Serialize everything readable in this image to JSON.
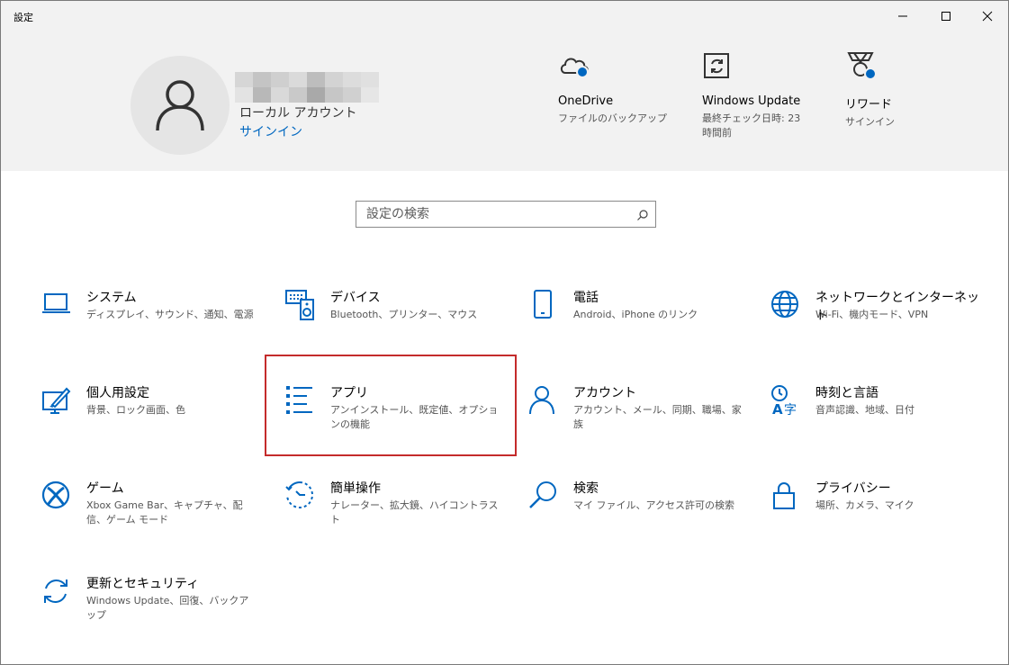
{
  "window": {
    "title": "設定"
  },
  "header": {
    "account_type": "ローカル アカウント",
    "signin_label": "サインイン",
    "quick_links": [
      {
        "title": "OneDrive",
        "sub": "ファイルのバックアップ",
        "icon": "onedrive-icon"
      },
      {
        "title": "Windows Update",
        "sub": "最終チェック日時: 23 時間前",
        "icon": "windows-update-icon"
      },
      {
        "title": "リワード",
        "sub": "サインイン",
        "icon": "rewards-icon"
      }
    ]
  },
  "search": {
    "placeholder": "設定の検索"
  },
  "categories": [
    {
      "title": "システム",
      "sub": "ディスプレイ、サウンド、通知、電源",
      "icon": "laptop-icon"
    },
    {
      "title": "デバイス",
      "sub": "Bluetooth、プリンター、マウス",
      "icon": "keyboard-speaker-icon"
    },
    {
      "title": "電話",
      "sub": "Android、iPhone のリンク",
      "icon": "phone-icon"
    },
    {
      "title": "ネットワークとインターネット",
      "sub": "Wi-Fi、機内モード、VPN",
      "icon": "globe-icon"
    },
    {
      "title": "個人用設定",
      "sub": "背景、ロック画面、色",
      "icon": "personalization-icon"
    },
    {
      "title": "アプリ",
      "sub": "アンインストール、既定値、オプションの機能",
      "icon": "apps-list-icon"
    },
    {
      "title": "アカウント",
      "sub": "アカウント、メール、同期、職場、家族",
      "icon": "person-icon"
    },
    {
      "title": "時刻と言語",
      "sub": "音声認識、地域、日付",
      "icon": "time-language-icon"
    },
    {
      "title": "ゲーム",
      "sub": "Xbox Game Bar、キャプチャ、配信、ゲーム モード",
      "icon": "xbox-icon"
    },
    {
      "title": "簡単操作",
      "sub": "ナレーター、拡大鏡、ハイコントラスト",
      "icon": "ease-of-access-icon"
    },
    {
      "title": "検索",
      "sub": "マイ ファイル、アクセス許可の検索",
      "icon": "search-magnifier-icon"
    },
    {
      "title": "プライバシー",
      "sub": "場所、カメラ、マイク",
      "icon": "lock-icon"
    },
    {
      "title": "更新とセキュリティ",
      "sub": "Windows Update、回復、バックアップ",
      "icon": "sync-arrows-icon"
    }
  ],
  "colors": {
    "accent": "#0067c0",
    "header_bg": "#f2f2f2",
    "highlight_border": "#c42b2b"
  }
}
